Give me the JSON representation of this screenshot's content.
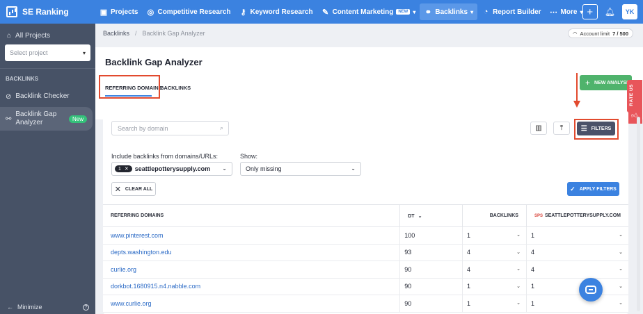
{
  "app": {
    "brand": "SE Ranking"
  },
  "nav": {
    "items": [
      {
        "label": "Projects",
        "icon": "projects-icon"
      },
      {
        "label": "Competitive Research",
        "icon": "target-icon"
      },
      {
        "label": "Keyword Research",
        "icon": "key-icon"
      },
      {
        "label": "Content Marketing",
        "icon": "edit-icon",
        "badge": "NEW"
      },
      {
        "label": "Backlinks",
        "icon": "link-icon"
      },
      {
        "label": "Report Builder",
        "icon": "pie-icon"
      },
      {
        "label": "More",
        "icon": "dots-icon"
      }
    ],
    "avatar": "YK"
  },
  "sidebar": {
    "all_projects": "All Projects",
    "select_placeholder": "Select project",
    "section": "BACKLINKS",
    "items": [
      {
        "label": "Backlink Checker"
      },
      {
        "label": "Backlink Gap Analyzer",
        "badge": "New"
      }
    ],
    "minimize": "Minimize"
  },
  "breadcrumb": {
    "root": "Backlinks",
    "current": "Backlink Gap Analyzer"
  },
  "account": {
    "label": "Account limit",
    "value": "7 / 500"
  },
  "page": {
    "title": "Backlink Gap Analyzer",
    "tabs": [
      "REFERRING DOMAINS",
      "BACKLINKS"
    ],
    "new_analysis": "NEW ANALYSIS",
    "rate_us": "RATE US"
  },
  "filters": {
    "search_placeholder": "Search by domain",
    "filters_label": "FILTERS",
    "include_label": "Include backlinks from domains/URLs:",
    "include_count": "1",
    "include_value": "seattlepotterysupply.com",
    "show_label": "Show:",
    "show_value": "Only missing",
    "clear_all": "CLEAR ALL",
    "apply": "APPLY FILTERS"
  },
  "table": {
    "headers": {
      "domain": "REFERRING DOMAINS",
      "dt": "DT",
      "backlinks": "BACKLINKS",
      "site_abbr": "SPS",
      "site": "SEATTLEPOTTERYSUPPLY.COM"
    },
    "rows": [
      {
        "domain": "www.pinterest.com",
        "dt": "100",
        "backlinks": "1",
        "site": "1"
      },
      {
        "domain": "depts.washington.edu",
        "dt": "93",
        "backlinks": "4",
        "site": "4"
      },
      {
        "domain": "curlie.org",
        "dt": "90",
        "backlinks": "4",
        "site": "4"
      },
      {
        "domain": "dorkbot.1680915.n4.nabble.com",
        "dt": "90",
        "backlinks": "1",
        "site": "1"
      },
      {
        "domain": "www.curlie.org",
        "dt": "90",
        "backlinks": "1",
        "site": "1"
      }
    ]
  },
  "colors": {
    "brand": "#3b82e0",
    "sidebar": "#475266",
    "highlight": "#e24a2e",
    "success": "#4fb36c"
  }
}
